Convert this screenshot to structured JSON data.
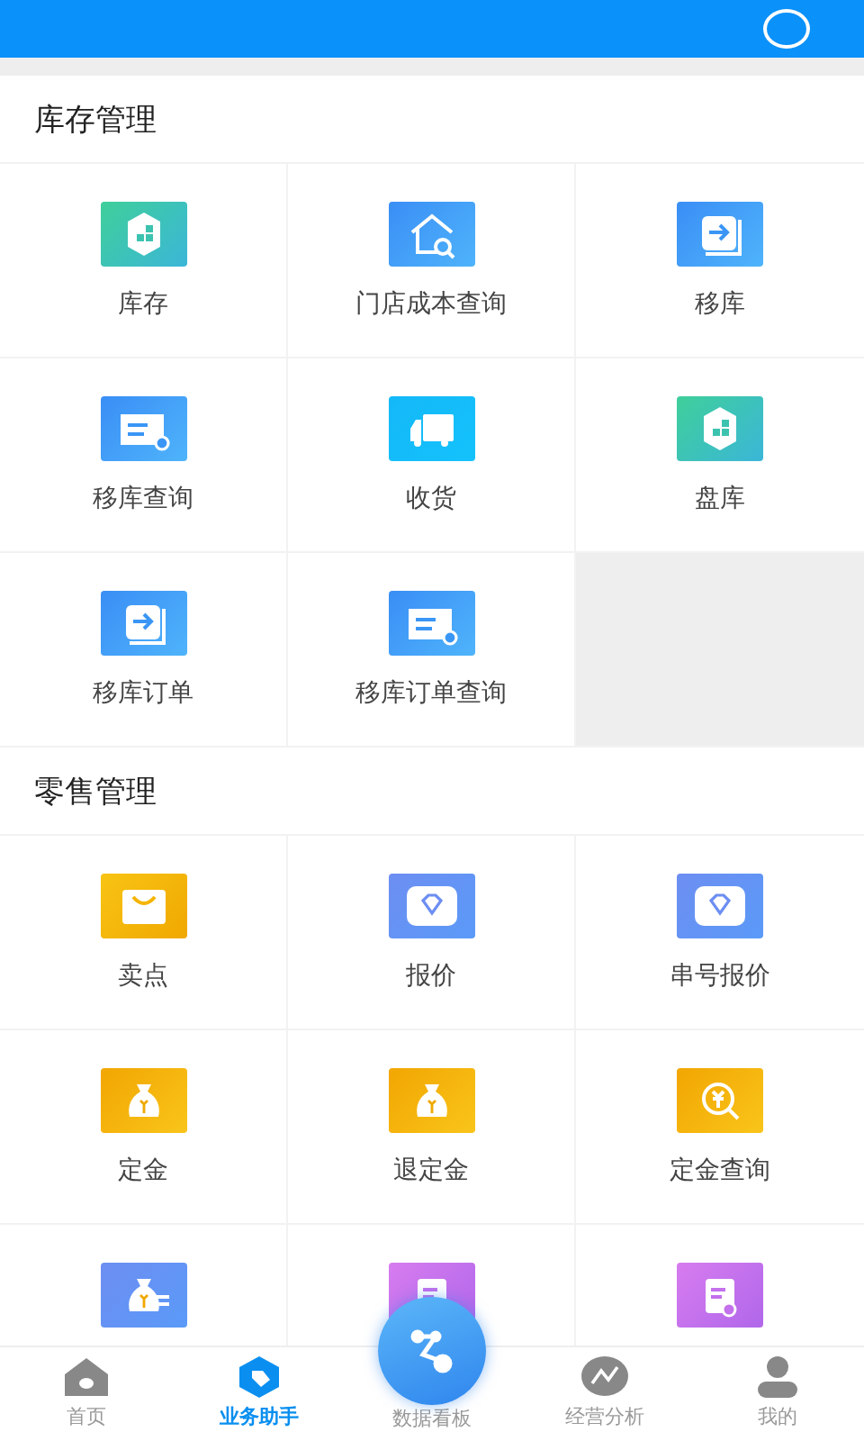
{
  "sections": [
    {
      "title": "库存管理",
      "items": [
        {
          "label": "库存",
          "kind": "stock"
        },
        {
          "label": "门店成本查询",
          "kind": "house-search"
        },
        {
          "label": "移库",
          "kind": "transfer"
        },
        {
          "label": "移库查询",
          "kind": "doc-search"
        },
        {
          "label": "收货",
          "kind": "truck"
        },
        {
          "label": "盘库",
          "kind": "stock"
        },
        {
          "label": "移库订单",
          "kind": "transfer"
        },
        {
          "label": "移库订单查询",
          "kind": "doc-search"
        },
        {
          "kind": "empty"
        }
      ]
    },
    {
      "title": "零售管理",
      "items": [
        {
          "label": "卖点",
          "kind": "bag"
        },
        {
          "label": "报价",
          "kind": "gem"
        },
        {
          "label": "串号报价",
          "kind": "gem"
        },
        {
          "label": "定金",
          "kind": "money-bag"
        },
        {
          "label": "退定金",
          "kind": "money-bag"
        },
        {
          "label": "定金查询",
          "kind": "yen-search"
        },
        {
          "kind": "money-transfer"
        },
        {
          "kind": "clipboard"
        },
        {
          "kind": "clipboard"
        }
      ]
    }
  ],
  "nav": [
    {
      "label": "首页",
      "kind": "home",
      "selected": false
    },
    {
      "label": "业务助手",
      "kind": "tag",
      "selected": true
    },
    {
      "label": "数据看板",
      "kind": "hub",
      "selected": false
    },
    {
      "label": "经营分析",
      "kind": "chart",
      "selected": false
    },
    {
      "label": "我的",
      "kind": "person",
      "selected": false
    }
  ]
}
